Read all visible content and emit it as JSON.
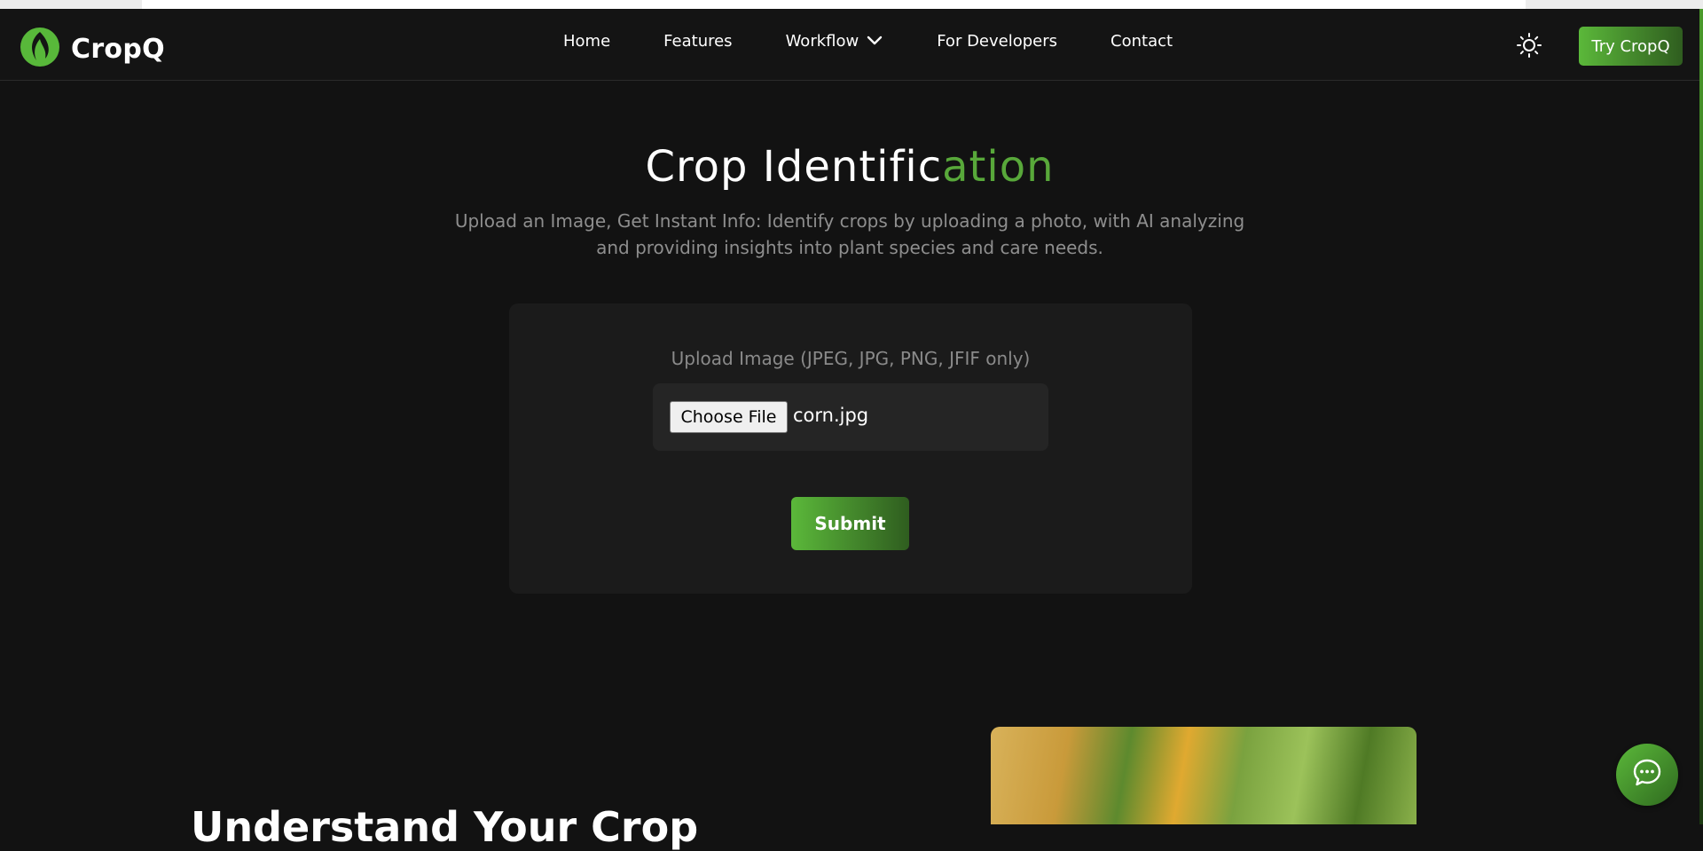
{
  "brand": {
    "name": "CropQ",
    "logo_icon": "leaf-flame-icon",
    "accent": "#58a83a"
  },
  "nav": {
    "home": "Home",
    "features": "Features",
    "workflow": "Workflow",
    "developers": "For Developers",
    "contact": "Contact",
    "theme_icon": "sun-icon",
    "cta": "Try CropQ"
  },
  "hero": {
    "title_main": "Crop Identific",
    "title_accent": "ation",
    "subtitle": "Upload an Image, Get Instant Info: Identify crops by uploading a photo, with AI analyzing and providing insights into plant species and care needs."
  },
  "upload": {
    "label": "Upload Image (JPEG, JPG, PNG, JFIF only)",
    "choose_button": "Choose File",
    "file_name": "corn.jpg",
    "submit": "Submit"
  },
  "section": {
    "heading_visible": "Understand Your Crop"
  },
  "chat": {
    "icon": "chat-bubble-icon"
  }
}
